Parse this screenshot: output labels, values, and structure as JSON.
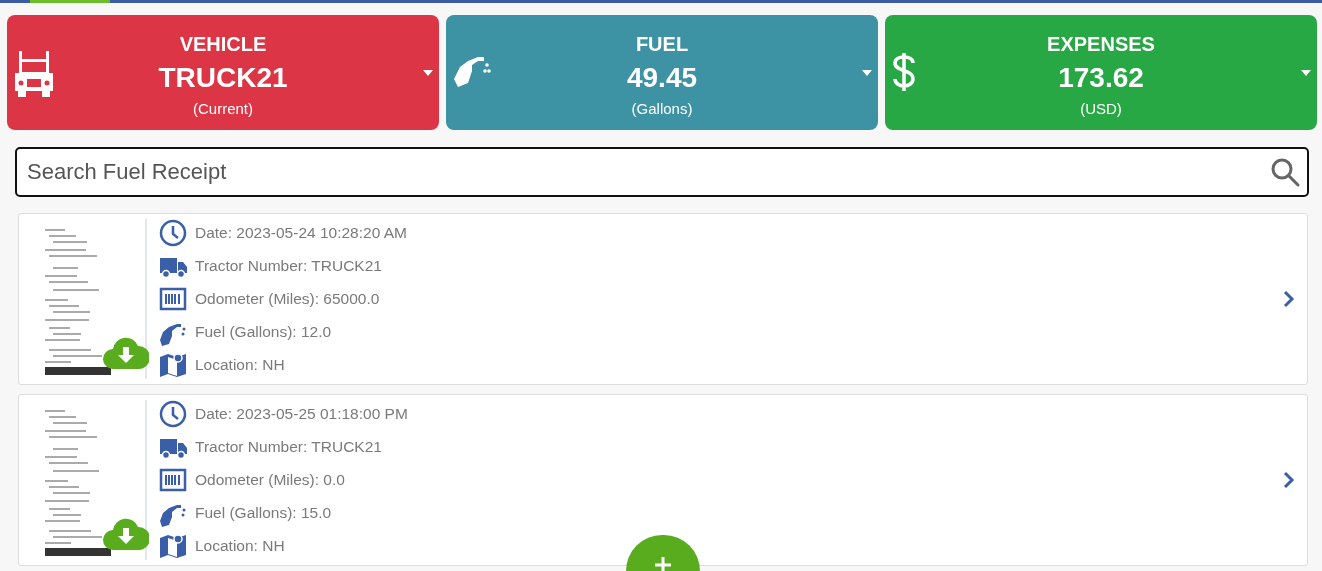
{
  "summary_cards": [
    {
      "kind": "vehicle",
      "title": "VEHICLE",
      "value": "TRUCK21",
      "unit": "(Current)",
      "color": "#dc3545"
    },
    {
      "kind": "fuel",
      "title": "FUEL",
      "value": "49.45",
      "unit": "(Gallons)",
      "color": "#3d93a3"
    },
    {
      "kind": "expenses",
      "title": "EXPENSES",
      "value": "173.62",
      "unit": "(USD)",
      "color": "#28a745"
    }
  ],
  "search": {
    "placeholder": "Search Fuel Receipt"
  },
  "receipts": [
    {
      "details": [
        {
          "kind": "date",
          "text": "Date: 2023-05-24 10:28:20 AM"
        },
        {
          "kind": "tractor",
          "text": "Tractor Number: TRUCK21"
        },
        {
          "kind": "odometer",
          "text": "Odometer (Miles): 65000.0"
        },
        {
          "kind": "fuel",
          "text": "Fuel (Gallons): 12.0"
        },
        {
          "kind": "location",
          "text": "Location: NH"
        }
      ]
    },
    {
      "details": [
        {
          "kind": "date",
          "text": "Date: 2023-05-25 01:18:00 PM"
        },
        {
          "kind": "tractor",
          "text": "Tractor Number: TRUCK21"
        },
        {
          "kind": "odometer",
          "text": "Odometer (Miles): 0.0"
        },
        {
          "kind": "fuel",
          "text": "Fuel (Gallons): 15.0"
        },
        {
          "kind": "location",
          "text": "Location: NH"
        }
      ]
    }
  ]
}
